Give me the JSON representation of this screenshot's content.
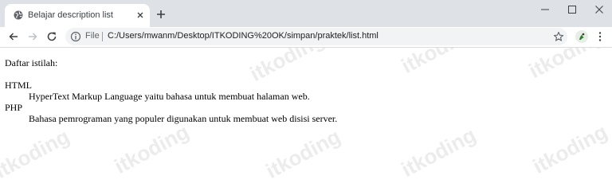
{
  "browser": {
    "tab_title": "Belajar description list",
    "address": {
      "scheme_label": "File",
      "url": "C:/Users/mwanm/Desktop/ITKODING%20OK/simpan/praktek/list.html"
    },
    "icons": {
      "tab_favicon": "globe-icon",
      "tab_close": "close-icon",
      "new_tab": "plus-icon",
      "minimize": "minimize-icon",
      "maximize": "maximize-icon",
      "close_window": "close-icon",
      "back": "back-arrow-icon",
      "forward": "forward-arrow-icon",
      "reload": "reload-icon",
      "info": "info-icon",
      "bookmark": "star-icon",
      "extension": "extension-icon",
      "menu": "kebab-menu-icon"
    },
    "colors": {
      "tab_strip": "#dee1e6",
      "omnibox": "#f1f3f4"
    }
  },
  "page": {
    "intro": "Daftar istilah:",
    "terms": [
      {
        "term": "HTML",
        "description": "HyperText Markup Language yaitu bahasa untuk membuat halaman web."
      },
      {
        "term": "PHP",
        "description": "Bahasa pemrograman yang populer digunakan untuk membuat web disisi server."
      }
    ],
    "watermark": "itkoding"
  }
}
